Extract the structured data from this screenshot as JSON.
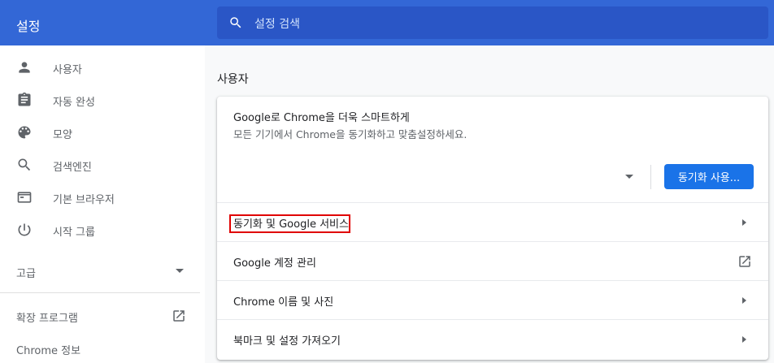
{
  "app": {
    "title": "설정"
  },
  "search": {
    "placeholder": "설정 검색",
    "icon": "search-icon"
  },
  "sidebar": {
    "items": [
      {
        "label": "사용자",
        "icon": "person-icon"
      },
      {
        "label": "자동 완성",
        "icon": "clipboard-icon"
      },
      {
        "label": "모양",
        "icon": "palette-icon"
      },
      {
        "label": "검색엔진",
        "icon": "search-icon"
      },
      {
        "label": "기본 브라우저",
        "icon": "browser-icon"
      },
      {
        "label": "시작 그룹",
        "icon": "power-icon"
      }
    ],
    "advanced_label": "고급",
    "extensions_label": "확장 프로그램",
    "about_label": "Chrome 정보"
  },
  "main": {
    "section_title": "사용자",
    "promo": {
      "title": "Google로 Chrome을 더욱 스마트하게",
      "subtitle": "모든 기기에서 Chrome을 동기화하고 맞춤설정하세요.",
      "sync_button": "동기화 사용..."
    },
    "rows": [
      {
        "label": "동기화 및 Google 서비스",
        "highlighted": true
      },
      {
        "label": "Google 계정 관리"
      },
      {
        "label": "Chrome 이름 및 사진"
      },
      {
        "label": "북마크 및 설정 가져오기"
      }
    ]
  },
  "colors": {
    "header": "#3367d6",
    "search_bg": "#2a56c6",
    "primary_button": "#1a73e8",
    "highlight_box": "#e00000"
  }
}
